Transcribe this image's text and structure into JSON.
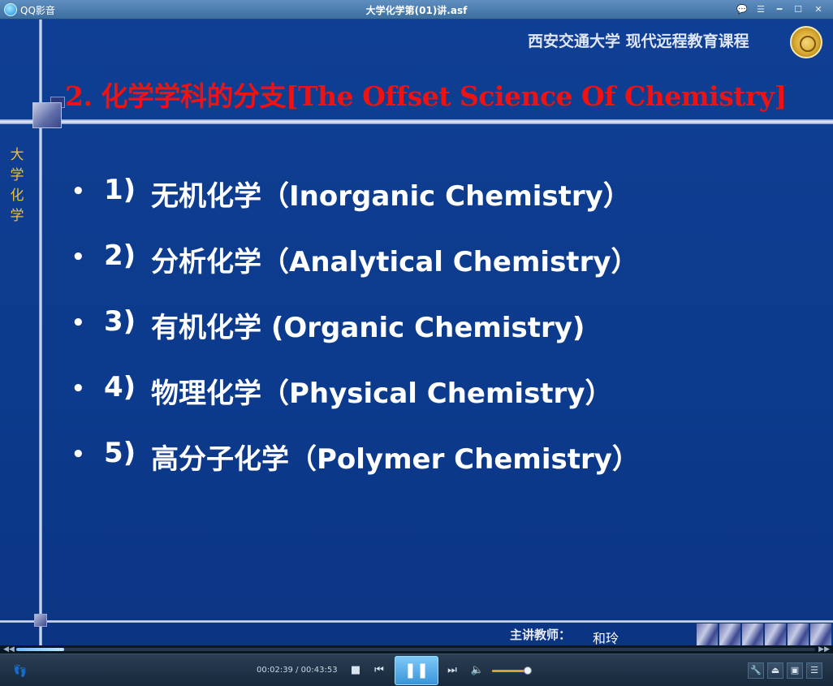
{
  "window": {
    "app_name": "QQ影音",
    "title": "大学化学第(01)讲.asf",
    "buttons": [
      "chat",
      "menu",
      "minimize",
      "maximize",
      "close"
    ]
  },
  "slide": {
    "university": "西安交通大学  现代远程教育课程",
    "side_label": [
      "大",
      "学",
      "化",
      "学"
    ],
    "title": "2. 化学学科的分支[The Offset Science Of Chemistry]",
    "bullets": [
      {
        "num": "1)",
        "text": "无机化学（Inorganic Chemistry）"
      },
      {
        "num": "2)",
        "text": "分析化学（Analytical Chemistry）"
      },
      {
        "num": "3)",
        "text": "有机化学 (Organic Chemistry)"
      },
      {
        "num": "4)",
        "text": "物理化学（Physical Chemistry）"
      },
      {
        "num": "5)",
        "text": "高分子化学（Polymer Chemistry）"
      }
    ],
    "teacher_label": "主讲教师：",
    "teacher_name": "和玲"
  },
  "player": {
    "current_time": "00:02:39",
    "total_time": "00:43:53",
    "time_display": "00:02:39 / 00:43:53",
    "progress_fraction": 0.06,
    "volume_fraction": 0.9,
    "state": "playing"
  },
  "icons": {
    "stop": "■",
    "prev": "⏮",
    "pause": "❚❚",
    "next": "⏭",
    "volume": "🔈",
    "footprint": "👣"
  }
}
